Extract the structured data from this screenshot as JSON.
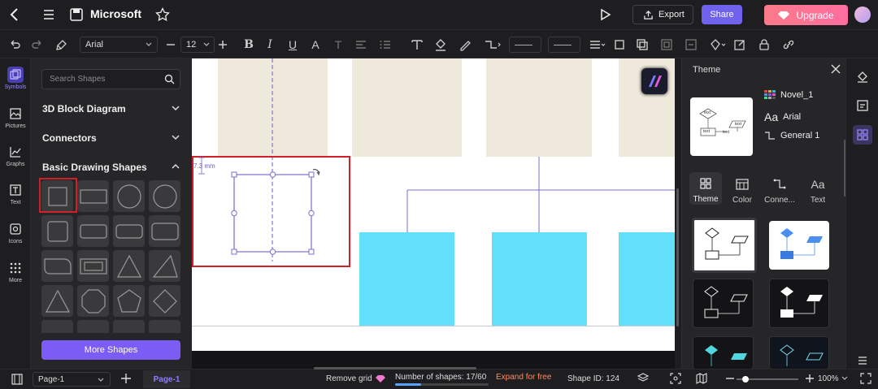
{
  "header": {
    "title": "Microsoft",
    "export_label": "Export",
    "share_label": "Share",
    "upgrade_label": "Upgrade"
  },
  "toolbar": {
    "font": "Arial",
    "font_size": "12"
  },
  "rail": {
    "items": [
      {
        "label": "Symbols",
        "icon": "symbols-icon"
      },
      {
        "label": "Pictures",
        "icon": "pictures-icon"
      },
      {
        "label": "Graphs",
        "icon": "graphs-icon"
      },
      {
        "label": "Text",
        "icon": "text-icon"
      },
      {
        "label": "Icons",
        "icon": "icons-icon"
      },
      {
        "label": "More",
        "icon": "more-icon"
      }
    ]
  },
  "panel": {
    "search_placeholder": "Search Shapes",
    "categories": [
      "3D Block Diagram",
      "Connectors",
      "Basic Drawing Shapes"
    ],
    "more_shapes_label": "More Shapes"
  },
  "canvas": {
    "dimension_label": "7.3 mm"
  },
  "theme": {
    "title": "Theme",
    "theme_name": "Novel_1",
    "font_name": "Arial",
    "connector_name": "General 1",
    "preview_texts": [
      "text",
      "text",
      "text",
      "text"
    ],
    "tabs": [
      "Theme",
      "Color",
      "Conne...",
      "Text"
    ]
  },
  "bottom": {
    "page_select": "Page-1",
    "page_tab": "Page-1",
    "remove_grid": "Remove grid",
    "shapes_count": "Number of shapes: 17/60",
    "expand": "Expand for free",
    "shape_id": "Shape ID: 124",
    "zoom": "100%"
  },
  "colors": {
    "accent": "#6f63ee",
    "selection": "#7b6fd0",
    "highlight_box": "#d0202a",
    "beige": "#efe9dc",
    "cyan": "#63e0f9"
  }
}
